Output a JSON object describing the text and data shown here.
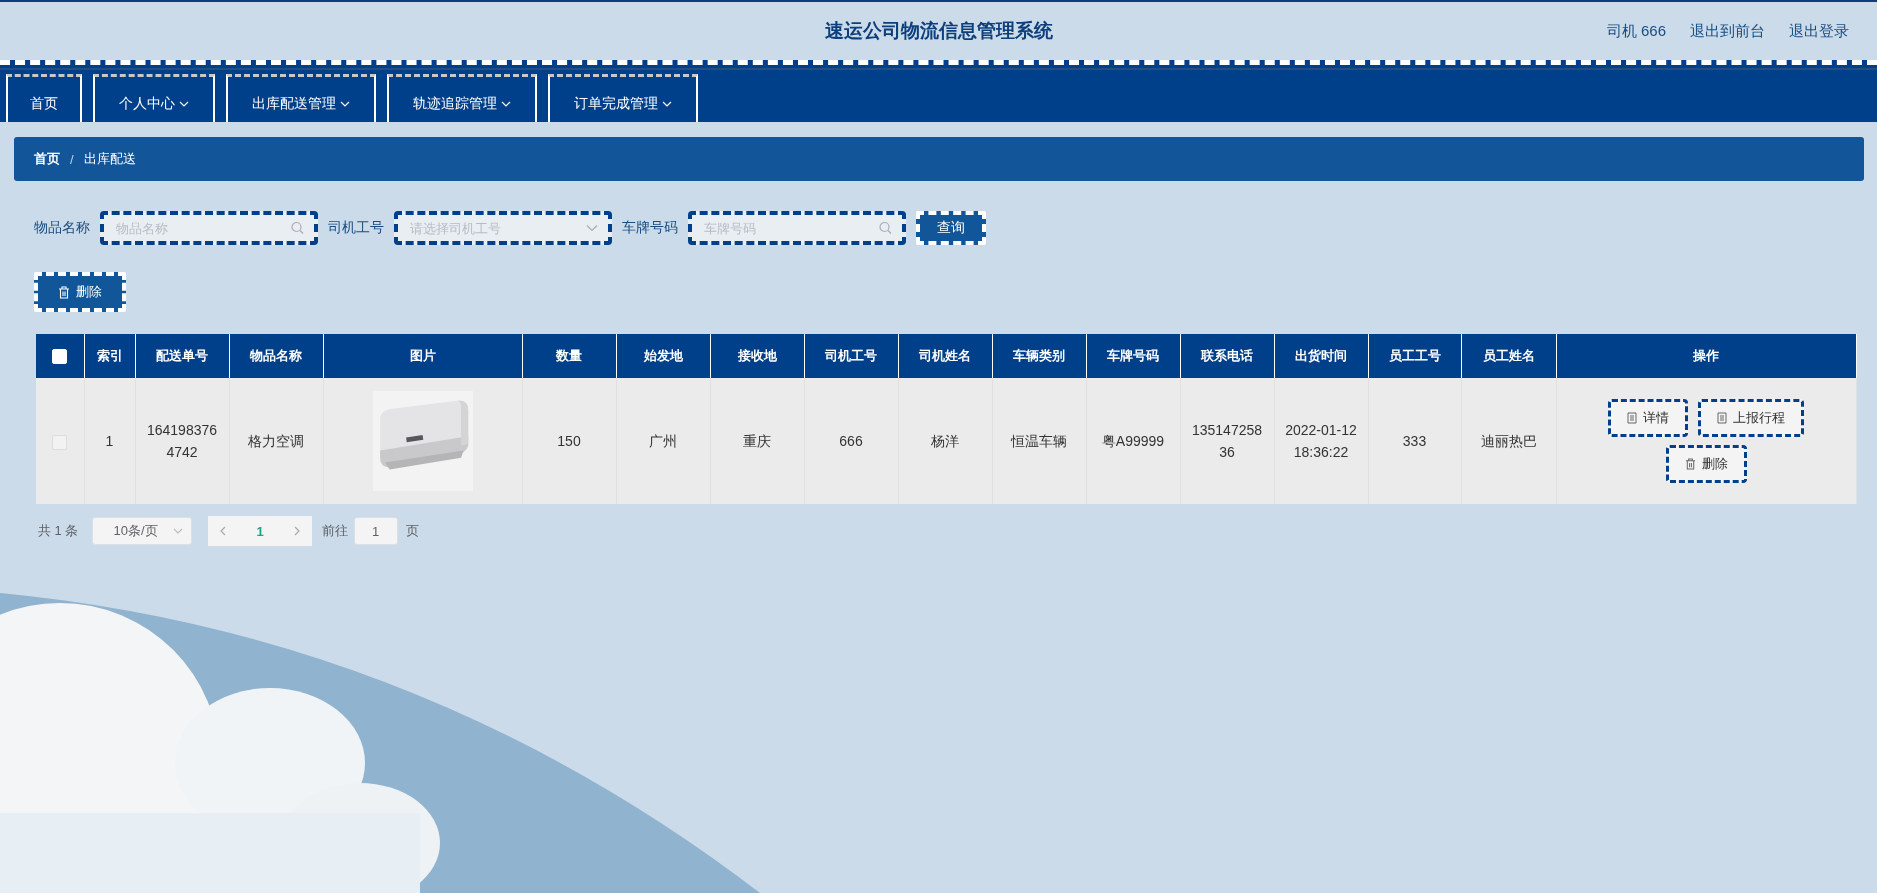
{
  "header": {
    "title": "速运公司物流信息管理系统",
    "links": [
      "司机 666",
      "退出到前台",
      "退出登录"
    ]
  },
  "nav": [
    {
      "label": "首页",
      "has_menu": false
    },
    {
      "label": "个人中心",
      "has_menu": true
    },
    {
      "label": "出库配送管理",
      "has_menu": true
    },
    {
      "label": "轨迹追踪管理",
      "has_menu": true
    },
    {
      "label": "订单完成管理",
      "has_menu": true
    }
  ],
  "breadcrumb": [
    "首页",
    "出库配送"
  ],
  "breadcrumb_separator": "/",
  "filters": [
    {
      "label": "物品名称",
      "kind": "search",
      "placeholder": "物品名称"
    },
    {
      "label": "司机工号",
      "kind": "select",
      "placeholder": "请选择司机工号"
    },
    {
      "label": "车牌号码",
      "kind": "search",
      "placeholder": "车牌号码"
    }
  ],
  "query_button": "查询",
  "delete_button": "删除",
  "table": {
    "select_all_checked": false,
    "columns": [
      "索引",
      "配送单号",
      "物品名称",
      "图片",
      "数量",
      "始发地",
      "接收地",
      "司机工号",
      "司机姓名",
      "车辆类别",
      "车牌号码",
      "联系电话",
      "出货时间",
      "员工工号",
      "员工姓名",
      "操作"
    ],
    "rows": [
      {
        "checked": false,
        "cells": [
          {
            "kind": "text",
            "text": "1"
          },
          {
            "kind": "text",
            "text": "1641983764742"
          },
          {
            "kind": "text",
            "text": "格力空调"
          },
          {
            "kind": "picture"
          },
          {
            "kind": "text",
            "text": "150"
          },
          {
            "kind": "text",
            "text": "广州"
          },
          {
            "kind": "text",
            "text": "重庆"
          },
          {
            "kind": "text",
            "text": "666"
          },
          {
            "kind": "text",
            "text": "杨洋"
          },
          {
            "kind": "text",
            "text": "恒温车辆"
          },
          {
            "kind": "text",
            "text": "粤A99999"
          },
          {
            "kind": "text",
            "text": "13514725836"
          },
          {
            "kind": "text",
            "text": "2022-01-12 18:36:22"
          },
          {
            "kind": "text",
            "text": "333"
          },
          {
            "kind": "text",
            "text": "迪丽热巴"
          }
        ],
        "actions": [
          {
            "label": "详情",
            "kind": "doc"
          },
          {
            "label": "上报行程",
            "kind": "doc"
          },
          {
            "label": "删除",
            "kind": "trash"
          }
        ]
      }
    ]
  },
  "pagination": {
    "total": "共 1 条",
    "page_size": "10条/页",
    "pages": [
      {
        "label": "1",
        "selected": true
      }
    ],
    "goto_label": "前往",
    "goto_value": "1",
    "goto_suffix": "页"
  }
}
